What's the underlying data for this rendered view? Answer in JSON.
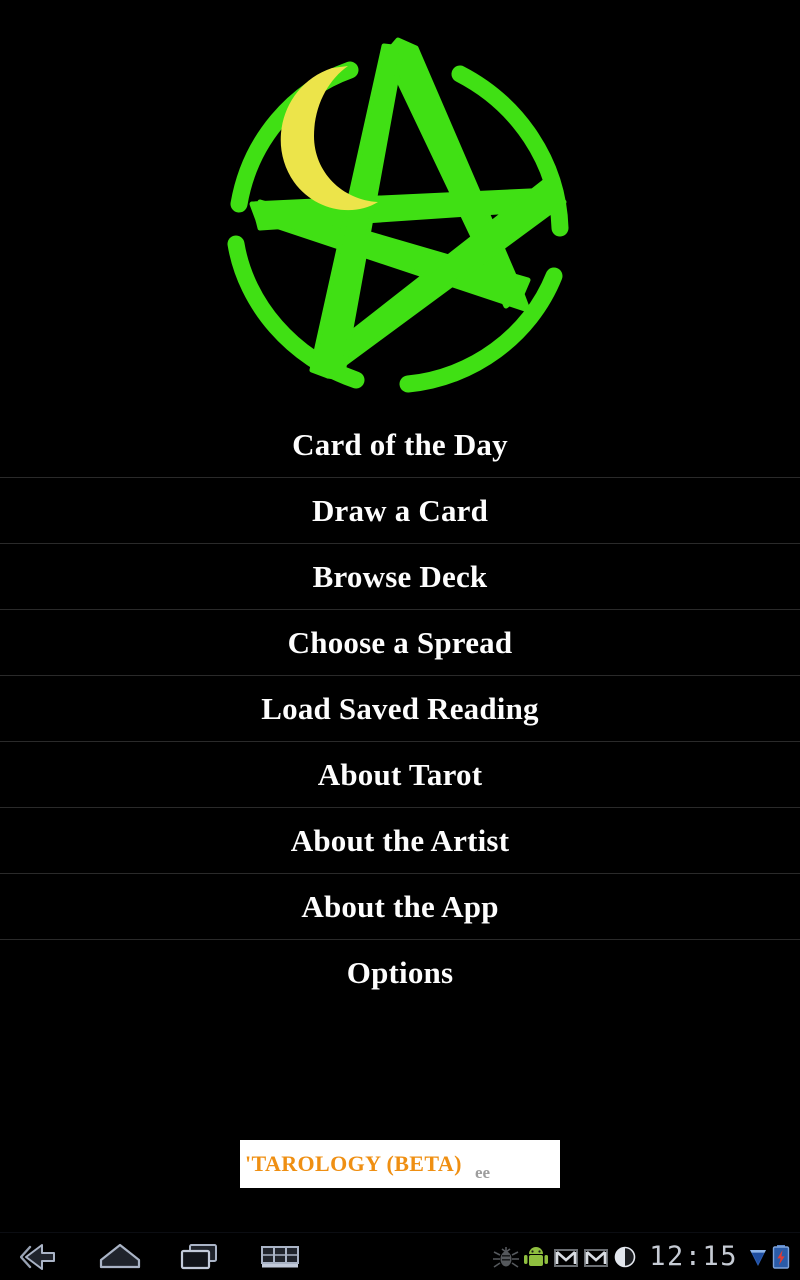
{
  "app": {
    "name": "Tarology",
    "background_color": "#000000"
  },
  "logo": {
    "name": "pentagram-logo",
    "description": "hand-drawn green pentagram inside a circle with a yellow crescent moon",
    "star_color": "#40e014",
    "circle_color": "#40e014",
    "moon_color": "#ece44a"
  },
  "menu": {
    "items": [
      {
        "label": "Card of the Day",
        "name": "menu-item-card-of-the-day"
      },
      {
        "label": "Draw a Card",
        "name": "menu-item-draw-a-card"
      },
      {
        "label": "Browse Deck",
        "name": "menu-item-browse-deck"
      },
      {
        "label": "Choose a Spread",
        "name": "menu-item-choose-a-spread"
      },
      {
        "label": "Load Saved Reading",
        "name": "menu-item-load-saved-reading"
      },
      {
        "label": "About Tarot",
        "name": "menu-item-about-tarot"
      },
      {
        "label": "About the Artist",
        "name": "menu-item-about-the-artist"
      },
      {
        "label": "About the App",
        "name": "menu-item-about-the-app"
      },
      {
        "label": "Options",
        "name": "menu-item-options"
      }
    ],
    "text_color": "#fdfdfd",
    "divider_color": "#2a2a2a"
  },
  "ad_banner": {
    "title": "'TAROLOGY  (BETA)",
    "subtitle": "ee",
    "title_color": "#ef8f12",
    "subtitle_color": "#9d9d9d",
    "background_color": "#ffffff"
  },
  "system_bar": {
    "nav_buttons": [
      {
        "label": "Back",
        "icon": "back-icon"
      },
      {
        "label": "Home",
        "icon": "home-icon"
      },
      {
        "label": "Recents",
        "icon": "recents-icon"
      },
      {
        "label": "Keyboard",
        "icon": "keyboard-icon"
      }
    ],
    "status_icons": [
      {
        "label": "USB debugging",
        "icon": "usb-debug-icon"
      },
      {
        "label": "Android",
        "icon": "android-robot-icon"
      },
      {
        "label": "Gmail",
        "icon": "gmail-icon"
      },
      {
        "label": "Gmail",
        "icon": "gmail-icon"
      },
      {
        "label": "Brightness",
        "icon": "half-circle-icon"
      }
    ],
    "clock": "12:15",
    "trailing_icons": [
      {
        "label": "Download",
        "icon": "download-triangle-icon"
      },
      {
        "label": "Battery charging",
        "icon": "battery-charging-icon"
      }
    ],
    "clock_color": "#c6cbd4"
  }
}
